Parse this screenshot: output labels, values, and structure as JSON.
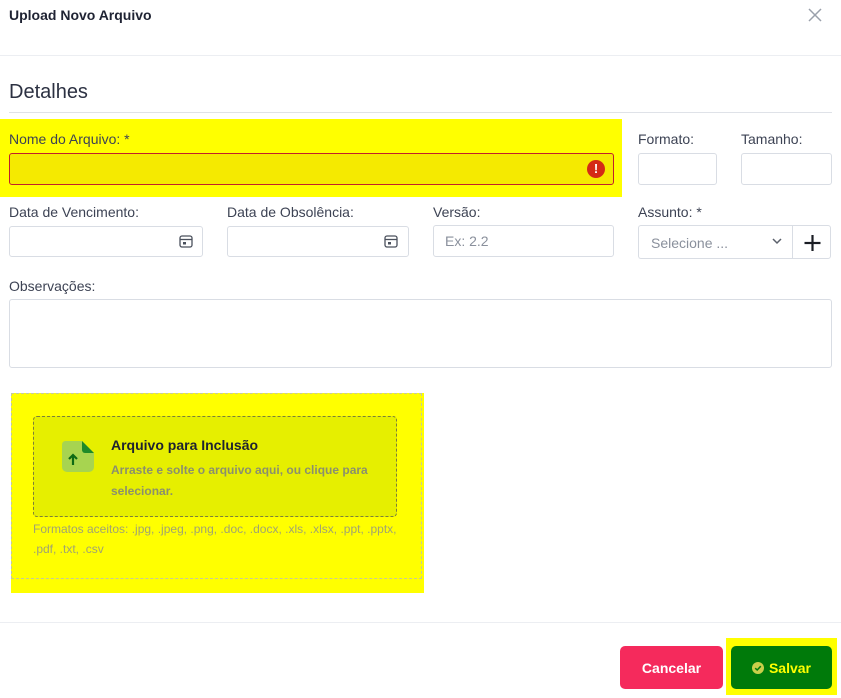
{
  "modal": {
    "title": "Upload Novo Arquivo"
  },
  "section": {
    "title": "Detalhes"
  },
  "fields": {
    "nome": {
      "label": "Nome do Arquivo: *",
      "value": ""
    },
    "formato": {
      "label": "Formato:",
      "value": ""
    },
    "tamanho": {
      "label": "Tamanho:",
      "value": ""
    },
    "vencimento": {
      "label": "Data de Vencimento:",
      "value": ""
    },
    "obsolescencia": {
      "label": "Data de Obsolência:",
      "value": ""
    },
    "versao": {
      "label": "Versão:",
      "placeholder": "Ex: 2.2",
      "value": ""
    },
    "assunto": {
      "label": "Assunto: *",
      "placeholder": "Selecione ..."
    },
    "observacoes": {
      "label": "Observações:",
      "value": ""
    }
  },
  "upload": {
    "title": "Arquivo para Inclusão",
    "subtitle": "Arraste e solte o arquivo aqui, ou clique para selecionar.",
    "formats": "Formatos aceitos: .jpg, .jpeg, .png, .doc, .docx, .xls, .xlsx, .ppt, .pptx, .pdf, .txt, .csv"
  },
  "buttons": {
    "cancel": "Cancelar",
    "save": "Salvar"
  },
  "icons": {
    "close": "close-icon",
    "error": "error-icon",
    "calendar": "calendar-icon",
    "chevron": "chevron-down-icon",
    "plus": "plus-icon",
    "file_upload": "file-upload-icon",
    "check": "check-circle-icon"
  },
  "colors": {
    "highlight": "#ffff00",
    "error": "#d42a16",
    "cancel": "#f52a5c",
    "save": "#007a0a",
    "save_text": "#ffff00"
  }
}
